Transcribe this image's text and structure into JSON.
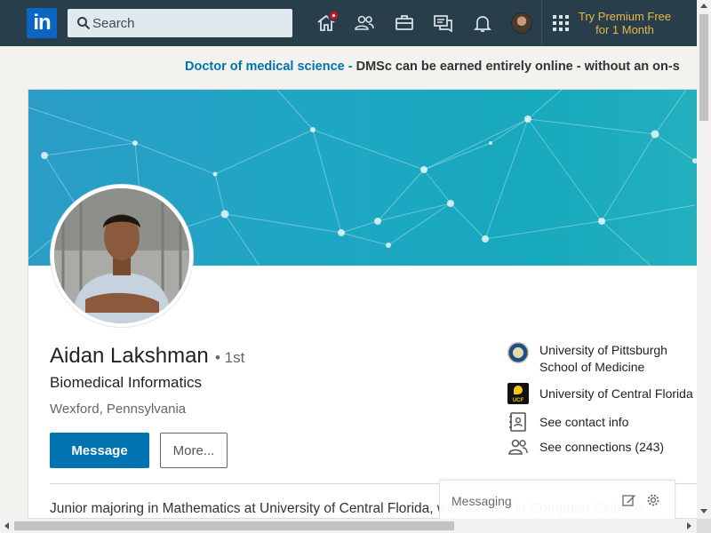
{
  "nav": {
    "logo_text": "in",
    "search_placeholder": "Search",
    "premium_line1": "Try Premium Free",
    "premium_line2": "for 1 Month",
    "icons": [
      "home-icon",
      "my-network-icon",
      "jobs-icon",
      "messaging-icon",
      "notifications-icon",
      "me-avatar",
      "work-apps-icon"
    ]
  },
  "ad": {
    "link_text": "Doctor of medical science -",
    "body_text": " DMSc can be earned entirely online - without an on-s"
  },
  "profile": {
    "name": "Aidan Lakshman",
    "degree": "• 1st",
    "headline": "Biomedical Informatics",
    "location": "Wexford, Pennsylvania",
    "message_button": "Message",
    "more_button": "More...",
    "summary": "Junior majoring in Mathematics at University of Central Florida, with a minor in Computer Science."
  },
  "sidebar": {
    "education_1_line1": "University of Pittsburgh",
    "education_1_line2": "School of Medicine",
    "education_2": "University of Central Florida",
    "education_2_logo_text": "UCF",
    "contact_info": "See contact info",
    "connections": "See connections (243)"
  },
  "messaging": {
    "label": "Messaging"
  },
  "colors": {
    "nav_bg": "#283e4a",
    "brand_blue": "#0073b1",
    "premium_gold": "#e7b84a",
    "banner_teal": "#1ea7c4"
  }
}
